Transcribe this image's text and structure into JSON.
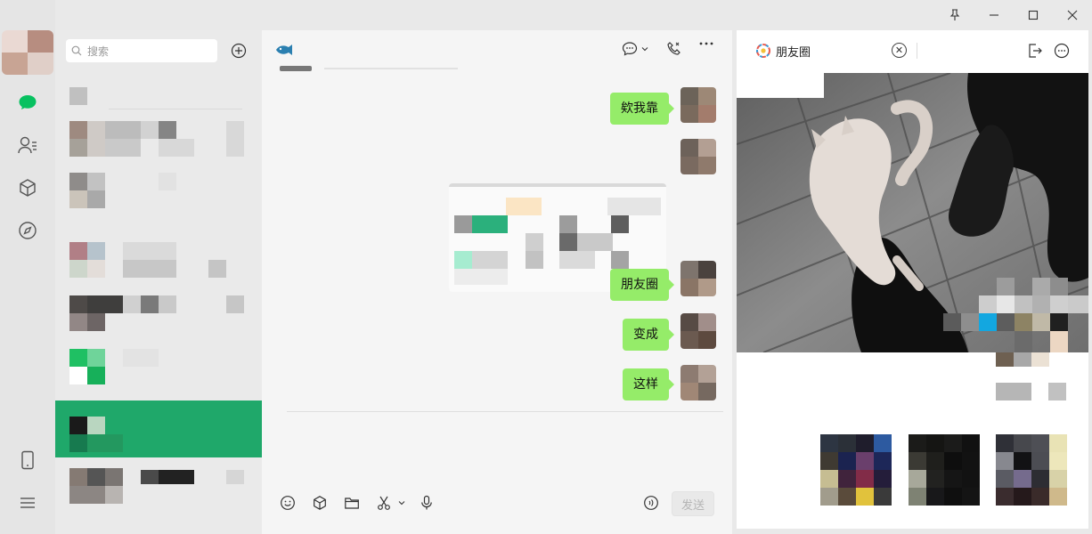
{
  "window": {
    "controls": [
      "pin-icon",
      "minimize-icon",
      "maximize-icon",
      "close-icon"
    ]
  },
  "rail": {
    "icons": [
      "chat-icon",
      "contacts-icon",
      "favorites-icon",
      "discover-icon",
      "phone-icon",
      "menu-icon"
    ],
    "active_color": "#07c160"
  },
  "session_list": {
    "search_placeholder": "搜索",
    "active_color": "#1fa86a"
  },
  "chat": {
    "messages": [
      {
        "type": "text",
        "from": "me",
        "text": "欸我靠"
      },
      {
        "type": "image",
        "from": "me"
      },
      {
        "type": "text",
        "from": "me",
        "text": "朋友圈"
      },
      {
        "type": "text",
        "from": "me",
        "text": "变成"
      },
      {
        "type": "text",
        "from": "me",
        "text": "这样"
      }
    ],
    "bubble_color": "#95ec69",
    "send_label": "发送"
  },
  "moments": {
    "tab_label": "朋友圈"
  }
}
